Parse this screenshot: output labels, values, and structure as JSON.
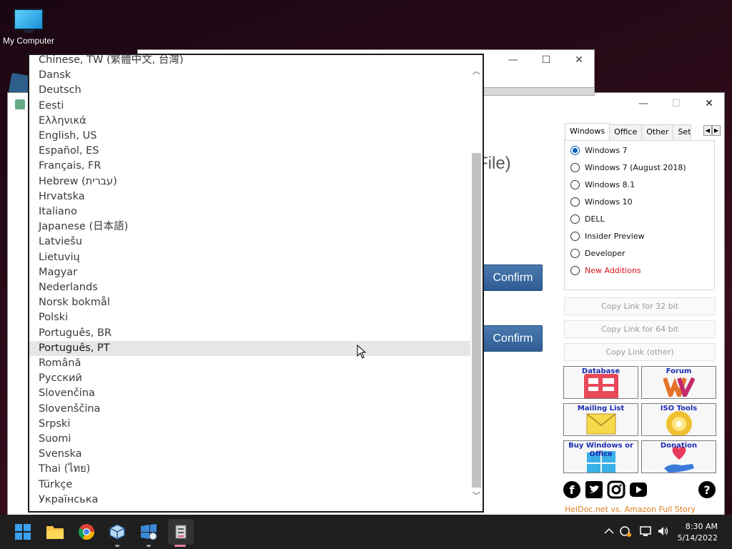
{
  "desktop": {
    "my_computer_label": "My Computer"
  },
  "window_controls": {
    "minimize": "—",
    "maximize": "☐",
    "close": "✕"
  },
  "main": {
    "partial_text": "File)",
    "confirm_1": "Confirm",
    "confirm_2": "Confirm"
  },
  "right_panel": {
    "tabs": [
      "Windows",
      "Office",
      "Other",
      "Set"
    ],
    "active_tab": "Windows",
    "radios": [
      {
        "label": "Windows 7",
        "checked": true
      },
      {
        "label": "Windows 7 (August 2018)",
        "checked": false
      },
      {
        "label": "Windows 8.1",
        "checked": false
      },
      {
        "label": "Windows 10",
        "checked": false
      },
      {
        "label": "DELL",
        "checked": false
      },
      {
        "label": "Insider Preview",
        "checked": false
      },
      {
        "label": "Developer",
        "checked": false
      },
      {
        "label": "New Additions",
        "checked": false,
        "color": "#d0101a"
      }
    ],
    "copy_32": "Copy Link for 32 bit",
    "copy_64": "Copy Link for 64 bit",
    "copy_other": "Copy Link (other)",
    "tiles": {
      "database": "Database",
      "forum": "Forum",
      "mailing": "Mailing List",
      "iso": "ISO Tools",
      "buy": "Buy Windows or Office",
      "donation": "Donation"
    },
    "story_link": "HeiDoc.net vs. Amazon Full Story"
  },
  "dropdown": {
    "items": [
      "Chinese, TW (繁體中文, 台灣)",
      "Dansk",
      "Deutsch",
      "Eesti",
      "Ελληνικά",
      "English, US",
      "Español, ES",
      "Français, FR",
      "Hebrew (עברית)",
      "Hrvatska",
      "Italiano",
      "Japanese (日本語)",
      "Latviešu",
      "Lietuvių",
      "Magyar",
      "Nederlands",
      "Norsk bokmål",
      "Polski",
      "Português, BR",
      "Português, PT",
      "Română",
      "Русский",
      "Slovenčina",
      "Slovenščina",
      "Srpski",
      "Suomi",
      "Svenska",
      "Thai (ไทย)",
      "Türkçe",
      "Українська"
    ],
    "hovered": "Português, PT"
  },
  "taskbar": {
    "time": "8:30 AM",
    "date": "5/14/2022"
  },
  "colors": {
    "accent": "#005fb8",
    "confirm": "#3a6aa3",
    "new_additions": "#d0101a",
    "story_link": "#e07f1e"
  }
}
